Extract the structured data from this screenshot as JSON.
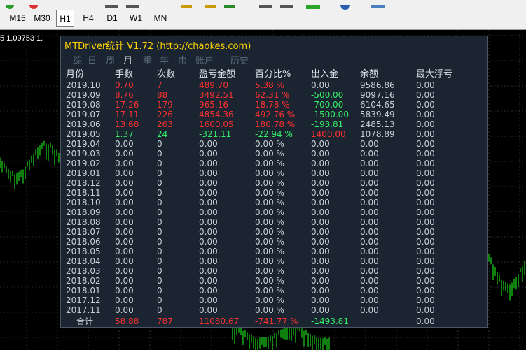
{
  "toolbar": {
    "timeframes": [
      {
        "label": "M15",
        "active": false
      },
      {
        "label": "M30",
        "active": false
      },
      {
        "label": "H1",
        "active": true
      },
      {
        "label": "H4",
        "active": false
      },
      {
        "label": "D1",
        "active": false
      },
      {
        "label": "W1",
        "active": false
      },
      {
        "label": "MN",
        "active": false
      }
    ]
  },
  "chart": {
    "price_label": "5 1.09753 1.",
    "colors": {
      "candle": "#19d619",
      "grid": "#2e2e2e",
      "background": "#000000"
    }
  },
  "panel": {
    "title": "MTDriver统计 V1.72  (http://chaokes.com)",
    "tabs": [
      "综",
      "日",
      "周",
      "月",
      "季",
      "年",
      "巾",
      "账户",
      "历史"
    ],
    "active_tab": "月",
    "headers": [
      "月份",
      "手数",
      "次数",
      "盈亏金额",
      "百分比%",
      "出入金",
      "余额",
      "最大浮亏"
    ],
    "rows": [
      {
        "month": "2019.10",
        "lots": "0.70",
        "count": "7",
        "pnl": "489.70",
        "pct": "5.38 %",
        "flow": "0.00",
        "balance": "9586.86",
        "maxdd": "0.00",
        "lc": "r",
        "cc": "r",
        "pc": "r",
        "fc": "w"
      },
      {
        "month": "2019.09",
        "lots": "8.76",
        "count": "88",
        "pnl": "3492.51",
        "pct": "62.31 %",
        "flow": "-500.00",
        "balance": "9097.16",
        "maxdd": "0.00",
        "lc": "r",
        "cc": "r",
        "pc": "r",
        "fc": "g"
      },
      {
        "month": "2019.08",
        "lots": "17.26",
        "count": "179",
        "pnl": "965.16",
        "pct": "18.78 %",
        "flow": "-700.00",
        "balance": "6104.65",
        "maxdd": "0.00",
        "lc": "r",
        "cc": "r",
        "pc": "r",
        "fc": "g"
      },
      {
        "month": "2019.07",
        "lots": "17.11",
        "count": "226",
        "pnl": "4854.36",
        "pct": "492.76 %",
        "flow": "-1500.00",
        "balance": "5839.49",
        "maxdd": "0.00",
        "lc": "r",
        "cc": "r",
        "pc": "r",
        "fc": "g"
      },
      {
        "month": "2019.06",
        "lots": "13.68",
        "count": "263",
        "pnl": "1600.05",
        "pct": "180.78 %",
        "flow": "-193.81",
        "balance": "2485.13",
        "maxdd": "0.00",
        "lc": "r",
        "cc": "r",
        "pc": "r",
        "fc": "g"
      },
      {
        "month": "2019.05",
        "lots": "1.37",
        "count": "24",
        "pnl": "-321.11",
        "pct": "-22.94 %",
        "flow": "1400.00",
        "balance": "1078.89",
        "maxdd": "0.00",
        "lc": "g",
        "cc": "g",
        "pc": "g",
        "fc": "r"
      },
      {
        "month": "2019.04",
        "lots": "0.00",
        "count": "0",
        "pnl": "0.00",
        "pct": "0.00 %",
        "flow": "0.00",
        "balance": "0.00",
        "maxdd": "0.00",
        "lc": "w",
        "cc": "w",
        "pc": "w",
        "fc": "w"
      },
      {
        "month": "2019.03",
        "lots": "0.00",
        "count": "0",
        "pnl": "0.00",
        "pct": "0.00 %",
        "flow": "0.00",
        "balance": "0.00",
        "maxdd": "0.00",
        "lc": "w",
        "cc": "w",
        "pc": "w",
        "fc": "w"
      },
      {
        "month": "2019.02",
        "lots": "0.00",
        "count": "0",
        "pnl": "0.00",
        "pct": "0.00 %",
        "flow": "0.00",
        "balance": "0.00",
        "maxdd": "0.00",
        "lc": "w",
        "cc": "w",
        "pc": "w",
        "fc": "w"
      },
      {
        "month": "2019.01",
        "lots": "0.00",
        "count": "0",
        "pnl": "0.00",
        "pct": "0.00 %",
        "flow": "0.00",
        "balance": "0.00",
        "maxdd": "0.00",
        "lc": "w",
        "cc": "w",
        "pc": "w",
        "fc": "w"
      },
      {
        "month": "2018.12",
        "lots": "0.00",
        "count": "0",
        "pnl": "0.00",
        "pct": "0.00 %",
        "flow": "0.00",
        "balance": "0.00",
        "maxdd": "0.00",
        "lc": "w",
        "cc": "w",
        "pc": "w",
        "fc": "w"
      },
      {
        "month": "2018.11",
        "lots": "0.00",
        "count": "0",
        "pnl": "0.00",
        "pct": "0.00 %",
        "flow": "0.00",
        "balance": "0.00",
        "maxdd": "0.00",
        "lc": "w",
        "cc": "w",
        "pc": "w",
        "fc": "w"
      },
      {
        "month": "2018.10",
        "lots": "0.00",
        "count": "0",
        "pnl": "0.00",
        "pct": "0.00 %",
        "flow": "0.00",
        "balance": "0.00",
        "maxdd": "0.00",
        "lc": "w",
        "cc": "w",
        "pc": "w",
        "fc": "w"
      },
      {
        "month": "2018.09",
        "lots": "0.00",
        "count": "0",
        "pnl": "0.00",
        "pct": "0.00 %",
        "flow": "0.00",
        "balance": "0.00",
        "maxdd": "0.00",
        "lc": "w",
        "cc": "w",
        "pc": "w",
        "fc": "w"
      },
      {
        "month": "2018.08",
        "lots": "0.00",
        "count": "0",
        "pnl": "0.00",
        "pct": "0.00 %",
        "flow": "0.00",
        "balance": "0.00",
        "maxdd": "0.00",
        "lc": "w",
        "cc": "w",
        "pc": "w",
        "fc": "w"
      },
      {
        "month": "2018.07",
        "lots": "0.00",
        "count": "0",
        "pnl": "0.00",
        "pct": "0.00 %",
        "flow": "0.00",
        "balance": "0.00",
        "maxdd": "0.00",
        "lc": "w",
        "cc": "w",
        "pc": "w",
        "fc": "w"
      },
      {
        "month": "2018.06",
        "lots": "0.00",
        "count": "0",
        "pnl": "0.00",
        "pct": "0.00 %",
        "flow": "0.00",
        "balance": "0.00",
        "maxdd": "0.00",
        "lc": "w",
        "cc": "w",
        "pc": "w",
        "fc": "w"
      },
      {
        "month": "2018.05",
        "lots": "0.00",
        "count": "0",
        "pnl": "0.00",
        "pct": "0.00 %",
        "flow": "0.00",
        "balance": "0.00",
        "maxdd": "0.00",
        "lc": "w",
        "cc": "w",
        "pc": "w",
        "fc": "w"
      },
      {
        "month": "2018.04",
        "lots": "0.00",
        "count": "0",
        "pnl": "0.00",
        "pct": "0.00 %",
        "flow": "0.00",
        "balance": "0.00",
        "maxdd": "0.00",
        "lc": "w",
        "cc": "w",
        "pc": "w",
        "fc": "w"
      },
      {
        "month": "2018.03",
        "lots": "0.00",
        "count": "0",
        "pnl": "0.00",
        "pct": "0.00 %",
        "flow": "0.00",
        "balance": "0.00",
        "maxdd": "0.00",
        "lc": "w",
        "cc": "w",
        "pc": "w",
        "fc": "w"
      },
      {
        "month": "2018.02",
        "lots": "0.00",
        "count": "0",
        "pnl": "0.00",
        "pct": "0.00 %",
        "flow": "0.00",
        "balance": "0.00",
        "maxdd": "0.00",
        "lc": "w",
        "cc": "w",
        "pc": "w",
        "fc": "w"
      },
      {
        "month": "2018.01",
        "lots": "0.00",
        "count": "0",
        "pnl": "0.00",
        "pct": "0.00 %",
        "flow": "0.00",
        "balance": "0.00",
        "maxdd": "0.00",
        "lc": "w",
        "cc": "w",
        "pc": "w",
        "fc": "w"
      },
      {
        "month": "2017.12",
        "lots": "0.00",
        "count": "0",
        "pnl": "0.00",
        "pct": "0.00 %",
        "flow": "0.00",
        "balance": "0.00",
        "maxdd": "0.00",
        "lc": "w",
        "cc": "w",
        "pc": "w",
        "fc": "w"
      },
      {
        "month": "2017.11",
        "lots": "0.00",
        "count": "0",
        "pnl": "0.00",
        "pct": "0.00 %",
        "flow": "0.00",
        "balance": "0.00",
        "maxdd": "0.00",
        "lc": "w",
        "cc": "w",
        "pc": "w",
        "fc": "w"
      }
    ],
    "total": {
      "label": "合计",
      "lots": "58.88",
      "count": "787",
      "pnl": "11080.67",
      "pct": "-741.77 %",
      "flow": "-1493.81",
      "maxdd": "0.00"
    },
    "colors": {
      "background": "#1b2531",
      "title": "#ffd400",
      "positive": "#ff3030",
      "negative": "#33ee66",
      "neutral": "#c8d0d8"
    }
  }
}
